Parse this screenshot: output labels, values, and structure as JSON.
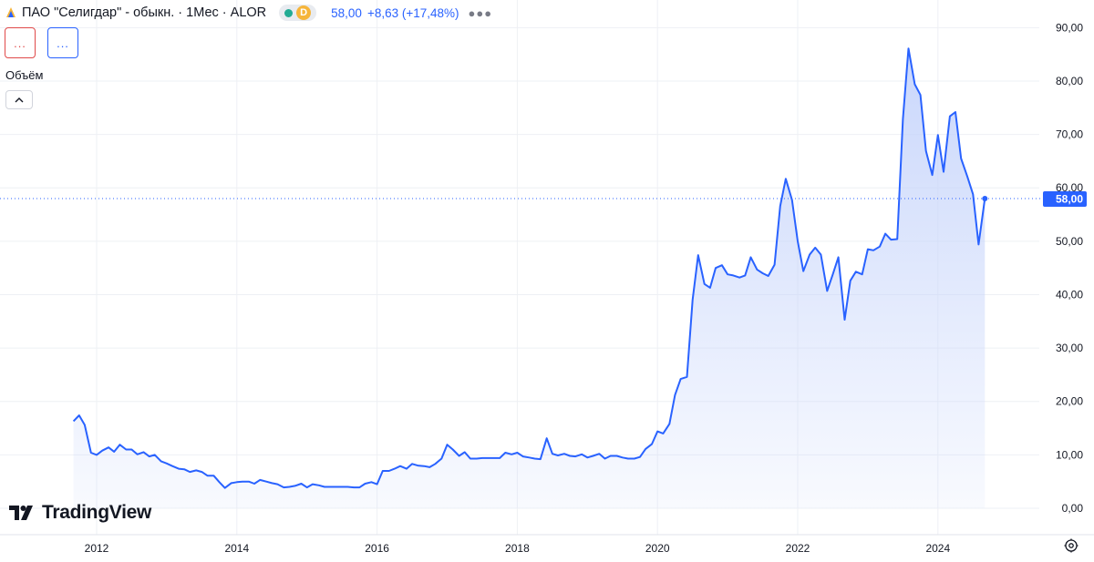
{
  "header": {
    "title": "ПАО \"Селигдар\" - обыкн. · 1Мес · ALOR",
    "status_badge": "D",
    "last_price": "58,00",
    "change": "+8,63 (+17,48%)",
    "more_icon": "more-dots-icon",
    "symbol_icon": "exchange-logo-icon"
  },
  "indicators": {
    "red_button_label": "...",
    "blue_button_label": "..."
  },
  "volume": {
    "label": "Объём",
    "collapse_icon": "chevron-up-icon"
  },
  "branding": {
    "logo_text": "TradingView",
    "logo_icon": "tradingview-logo-icon"
  },
  "settings": {
    "icon": "settings-gear-icon"
  },
  "colors": {
    "line": "#2962ff",
    "fill_top": "#c7d5fb",
    "grid": "#eef0f4",
    "last_price_badge": "#2962ff",
    "axis_text": "#131722"
  },
  "chart_data": {
    "type": "area",
    "title": "",
    "xlabel": "",
    "ylabel": "",
    "grid": true,
    "ylim": [
      0,
      90
    ],
    "y_ticks": [
      "0,00",
      "10,00",
      "20,00",
      "30,00",
      "40,00",
      "50,00",
      "60,00",
      "70,00",
      "80,00",
      "90,00"
    ],
    "x_ticks": [
      "2012",
      "2014",
      "2016",
      "2018",
      "2020",
      "2022",
      "2024"
    ],
    "last_value_label": "58,00",
    "series": [
      {
        "values": [
          [
            2011.67,
            16.3
          ],
          [
            2011.75,
            17.4
          ],
          [
            2011.83,
            15.6
          ],
          [
            2011.92,
            10.4
          ],
          [
            2012.0,
            10.0
          ],
          [
            2012.08,
            10.8
          ],
          [
            2012.17,
            11.4
          ],
          [
            2012.25,
            10.6
          ],
          [
            2012.33,
            11.9
          ],
          [
            2012.42,
            11.0
          ],
          [
            2012.5,
            11.0
          ],
          [
            2012.58,
            10.1
          ],
          [
            2012.67,
            10.5
          ],
          [
            2012.75,
            9.7
          ],
          [
            2012.83,
            10.0
          ],
          [
            2012.92,
            8.8
          ],
          [
            2013.0,
            8.4
          ],
          [
            2013.08,
            7.9
          ],
          [
            2013.17,
            7.4
          ],
          [
            2013.25,
            7.3
          ],
          [
            2013.33,
            6.8
          ],
          [
            2013.42,
            7.1
          ],
          [
            2013.5,
            6.8
          ],
          [
            2013.58,
            6.1
          ],
          [
            2013.67,
            6.1
          ],
          [
            2013.75,
            4.9
          ],
          [
            2013.83,
            3.8
          ],
          [
            2013.92,
            4.7
          ],
          [
            2014.0,
            4.9
          ],
          [
            2014.08,
            5.0
          ],
          [
            2014.17,
            5.0
          ],
          [
            2014.25,
            4.6
          ],
          [
            2014.33,
            5.3
          ],
          [
            2014.42,
            5.0
          ],
          [
            2014.5,
            4.7
          ],
          [
            2014.58,
            4.5
          ],
          [
            2014.67,
            3.9
          ],
          [
            2014.75,
            4.0
          ],
          [
            2014.83,
            4.2
          ],
          [
            2014.92,
            4.6
          ],
          [
            2015.0,
            3.9
          ],
          [
            2015.08,
            4.5
          ],
          [
            2015.17,
            4.3
          ],
          [
            2015.25,
            4.0
          ],
          [
            2015.33,
            4.0
          ],
          [
            2015.42,
            4.0
          ],
          [
            2015.5,
            4.0
          ],
          [
            2015.58,
            4.0
          ],
          [
            2015.67,
            3.9
          ],
          [
            2015.75,
            3.9
          ],
          [
            2015.83,
            4.6
          ],
          [
            2015.92,
            4.9
          ],
          [
            2016.0,
            4.5
          ],
          [
            2016.08,
            7.0
          ],
          [
            2016.17,
            7.0
          ],
          [
            2016.25,
            7.4
          ],
          [
            2016.33,
            7.9
          ],
          [
            2016.42,
            7.4
          ],
          [
            2016.5,
            8.3
          ],
          [
            2016.58,
            8.0
          ],
          [
            2016.67,
            7.9
          ],
          [
            2016.75,
            7.7
          ],
          [
            2016.83,
            8.3
          ],
          [
            2016.92,
            9.3
          ],
          [
            2017.0,
            11.9
          ],
          [
            2017.08,
            11.0
          ],
          [
            2017.17,
            9.8
          ],
          [
            2017.25,
            10.5
          ],
          [
            2017.33,
            9.3
          ],
          [
            2017.42,
            9.3
          ],
          [
            2017.5,
            9.4
          ],
          [
            2017.58,
            9.4
          ],
          [
            2017.67,
            9.4
          ],
          [
            2017.75,
            9.4
          ],
          [
            2017.83,
            10.4
          ],
          [
            2017.92,
            10.1
          ],
          [
            2018.0,
            10.4
          ],
          [
            2018.08,
            9.7
          ],
          [
            2018.17,
            9.5
          ],
          [
            2018.25,
            9.3
          ],
          [
            2018.33,
            9.2
          ],
          [
            2018.42,
            13.1
          ],
          [
            2018.5,
            10.2
          ],
          [
            2018.58,
            9.9
          ],
          [
            2018.67,
            10.2
          ],
          [
            2018.75,
            9.8
          ],
          [
            2018.83,
            9.7
          ],
          [
            2018.92,
            10.1
          ],
          [
            2019.0,
            9.5
          ],
          [
            2019.08,
            9.8
          ],
          [
            2019.17,
            10.2
          ],
          [
            2019.25,
            9.3
          ],
          [
            2019.33,
            9.8
          ],
          [
            2019.42,
            9.8
          ],
          [
            2019.5,
            9.5
          ],
          [
            2019.58,
            9.3
          ],
          [
            2019.67,
            9.3
          ],
          [
            2019.75,
            9.6
          ],
          [
            2019.83,
            11.1
          ],
          [
            2019.92,
            12.0
          ],
          [
            2020.0,
            14.4
          ],
          [
            2020.08,
            14.0
          ],
          [
            2020.17,
            15.8
          ],
          [
            2020.25,
            21.2
          ],
          [
            2020.33,
            24.2
          ],
          [
            2020.42,
            24.6
          ],
          [
            2020.5,
            39.0
          ],
          [
            2020.58,
            47.4
          ],
          [
            2020.67,
            42.0
          ],
          [
            2020.75,
            41.3
          ],
          [
            2020.83,
            45.0
          ],
          [
            2020.92,
            45.5
          ],
          [
            2021.0,
            43.8
          ],
          [
            2021.08,
            43.6
          ],
          [
            2021.17,
            43.2
          ],
          [
            2021.25,
            43.6
          ],
          [
            2021.33,
            47.0
          ],
          [
            2021.42,
            44.7
          ],
          [
            2021.5,
            44.0
          ],
          [
            2021.58,
            43.5
          ],
          [
            2021.67,
            45.6
          ],
          [
            2021.75,
            56.6
          ],
          [
            2021.83,
            61.7
          ],
          [
            2021.92,
            57.7
          ],
          [
            2022.0,
            50.0
          ],
          [
            2022.08,
            44.4
          ],
          [
            2022.17,
            47.5
          ],
          [
            2022.25,
            48.8
          ],
          [
            2022.33,
            47.5
          ],
          [
            2022.42,
            40.7
          ],
          [
            2022.5,
            43.8
          ],
          [
            2022.58,
            47.0
          ],
          [
            2022.67,
            35.3
          ],
          [
            2022.75,
            42.6
          ],
          [
            2022.83,
            44.3
          ],
          [
            2022.92,
            43.8
          ],
          [
            2023.0,
            48.5
          ],
          [
            2023.08,
            48.3
          ],
          [
            2023.17,
            49.0
          ],
          [
            2023.25,
            51.4
          ],
          [
            2023.33,
            50.3
          ],
          [
            2023.42,
            50.4
          ],
          [
            2023.5,
            72.9
          ],
          [
            2023.58,
            86.1
          ],
          [
            2023.67,
            79.4
          ],
          [
            2023.75,
            77.4
          ],
          [
            2023.83,
            66.9
          ],
          [
            2023.92,
            62.4
          ],
          [
            2024.0,
            69.9
          ],
          [
            2024.08,
            63.0
          ],
          [
            2024.17,
            73.4
          ],
          [
            2024.25,
            74.2
          ],
          [
            2024.33,
            65.5
          ],
          [
            2024.42,
            62.1
          ],
          [
            2024.5,
            58.8
          ],
          [
            2024.58,
            49.4
          ],
          [
            2024.67,
            58.0
          ]
        ]
      }
    ]
  }
}
